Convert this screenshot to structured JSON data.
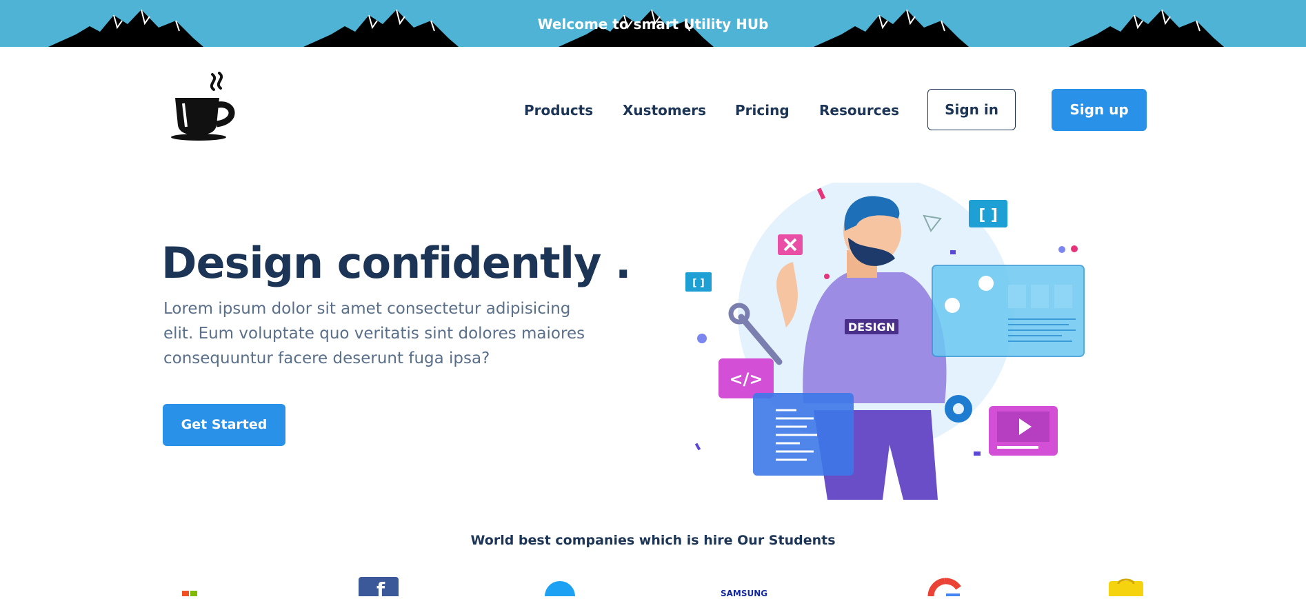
{
  "banner": {
    "text": "Welcome to smart Utility HUb",
    "color": "#4fb3d6"
  },
  "logo": {
    "icon": "coffee-cup-icon"
  },
  "nav": {
    "links": [
      "Products",
      "Xustomers",
      "Pricing",
      "Resources"
    ],
    "signin_label": "Sign in",
    "signup_label": "Sign up"
  },
  "hero": {
    "title": "Design confidently .",
    "subtitle": "Lorem ipsum dolor sit amet consectetur adipisicing elit. Eum voluptate quo veritatis sint dolores maiores consequuntur facere deserunt fuga ipsa?",
    "cta_label": "Get Started",
    "badge_text": "DESIGN"
  },
  "companies": {
    "title": "World best companies which is hire Our Students",
    "logos": [
      "microsoft-icon",
      "facebook-icon",
      "twitter-icon",
      "samsung-icon",
      "google-icon",
      "shopping-bag-icon"
    ]
  },
  "colors": {
    "accent": "#2a91e8",
    "text": "#1c3556",
    "muted": "#5a6f8a"
  }
}
